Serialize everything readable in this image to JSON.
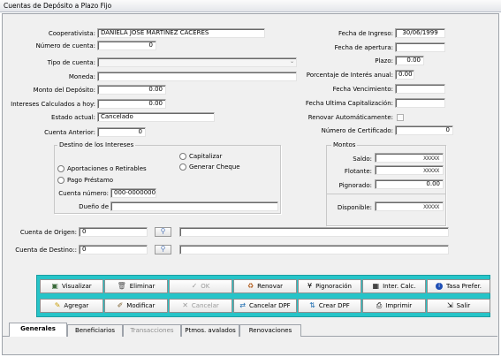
{
  "window": {
    "title": "Cuentas de Depósito a Plazo Fijo"
  },
  "left": {
    "cooperativista_label": "Cooperativista:",
    "cooperativista_value": "DANIELA JOSE MARTINEZ CACERES",
    "numero_cuenta_label": "Número de cuenta:",
    "numero_cuenta_value": "0",
    "tipo_cuenta_label": "Tipo de cuenta:",
    "tipo_cuenta_value": "",
    "moneda_label": "Moneda:",
    "moneda_value": "",
    "monto_label": "Monto del Depósito:",
    "monto_value": "0.00",
    "intereses_label": "Intereses Calculados a hoy:",
    "intereses_value": "0.00",
    "estado_label": "Estado actual:",
    "estado_value": "Cancelado",
    "cuenta_anterior_label": "Cuenta Anterior:",
    "cuenta_anterior_value": "0"
  },
  "right": {
    "fecha_ingreso_label": "Fecha de Ingreso:",
    "fecha_ingreso_value": "30/06/1999",
    "fecha_apertura_label": "Fecha de apertura:",
    "fecha_apertura_value": "",
    "plazo_label": "Plazo:",
    "plazo_value": "0.00",
    "porcentaje_label": "Porcentaje de Interés anual:",
    "porcentaje_value": "0.00",
    "fecha_venc_label": "Fecha Vencimiento:",
    "fecha_venc_value": "",
    "fecha_cap_label": "Fecha Ultima Capitalización:",
    "fecha_cap_value": "",
    "renovar_label": "Renovar Automáticamente:",
    "certificado_label": "Número de Certificado:",
    "certificado_value": "0"
  },
  "destino": {
    "title": "Destino de los Intereses",
    "opt_aportaciones": "Aportaciones o Retirables",
    "opt_pago": "Pago Préstamo",
    "opt_capitalizar": "Capitalizar",
    "opt_cheque": "Generar Cheque",
    "cuenta_numero_label": "Cuenta número:",
    "cuenta_numero_value": "000-0000000",
    "dueno_label": "Dueño de",
    "dueno_value": ""
  },
  "montos": {
    "title": "Montos",
    "saldo_label": "Saldo:",
    "saldo_value": "XXXXX",
    "flotante_label": "Flotante:",
    "flotante_value": "XXXXX",
    "pignorado_label": "Pignorado:",
    "pignorado_value": "0.00",
    "disponible_label": "Disponible:",
    "disponible_value": "XXXXX"
  },
  "cuentas": {
    "origen_label": "Cuenta de Origen:",
    "origen_value": "0",
    "destino_label": "Cuenta de Destino::",
    "destino_value": "0"
  },
  "buttons": {
    "visualizar": "Visualizar",
    "eliminar": "Eliminar",
    "ok": "OK",
    "renovar": "Renovar",
    "pignoracion": "Pignoración",
    "inter_calc": "Inter. Calc.",
    "tasa_prefer": "Tasa Prefer.",
    "agregar": "Agregar",
    "modificar": "Modificar",
    "cancelar": "Cancelar",
    "cancelar_dpf": "Cancelar DPF",
    "crear_dpf": "Crear DPF",
    "imprimir": "Imprimir",
    "salir": "Salir"
  },
  "tabs": [
    "Generales",
    "Beneficiarios",
    "Transacciones",
    "Ptmos. avalados",
    "Renovaciones"
  ],
  "colors": {
    "toolbar": "#26c4c8",
    "background": "#f0f0f0"
  }
}
